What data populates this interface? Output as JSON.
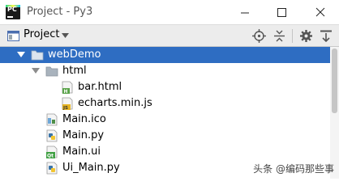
{
  "window": {
    "title": "Project - Py3",
    "accent": "#2e6dc2"
  },
  "toolbar": {
    "panel_label": "Project",
    "icons": [
      "locate-icon",
      "collapse-all-icon",
      "gear-icon",
      "hide-icon"
    ]
  },
  "tree": {
    "root": "webDemo",
    "folder_html": "html",
    "files": {
      "bar_html": "bar.html",
      "echarts": "echarts.min.js",
      "main_ico": "Main.ico",
      "main_py": "Main.py",
      "main_ui": "Main.ui",
      "ui_main_py": "Ui_Main.py"
    }
  },
  "watermark": "头条 @编码那些事"
}
